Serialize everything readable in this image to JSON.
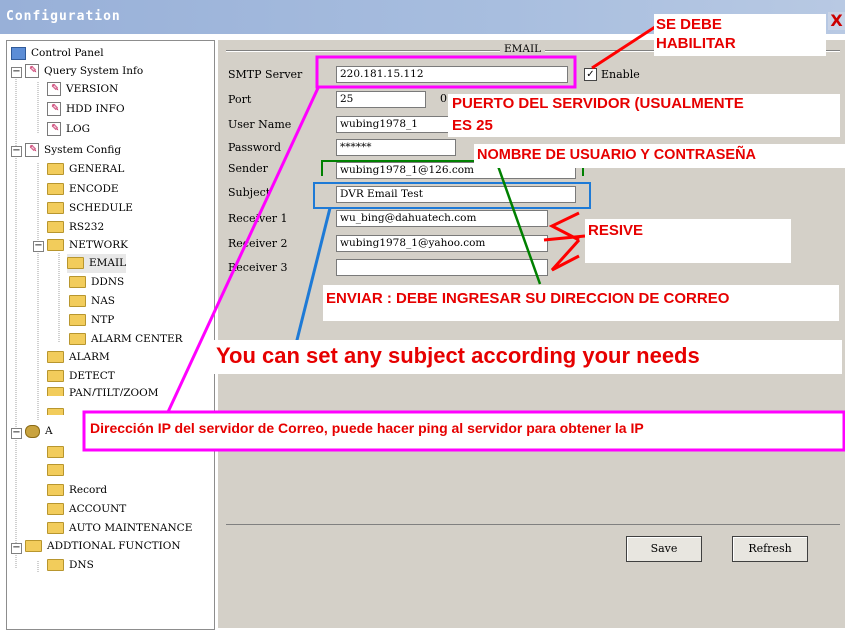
{
  "window": {
    "title": "Configuration",
    "close_glyph": "X"
  },
  "tree": {
    "control_panel": "Control Panel",
    "query_system_info": "Query System Info",
    "version": "VERSION",
    "hdd_info": "HDD INFO",
    "log": "LOG",
    "system_config": "System Config",
    "general": "GENERAL",
    "encode": "ENCODE",
    "schedule": "SCHEDULE",
    "rs232": "RS232",
    "network": "NETWORK",
    "email": "EMAIL",
    "ddns": "DDNS",
    "nas": "NAS",
    "ntp": "NTP",
    "alarm_center": "ALARM CENTER",
    "alarm": "ALARM",
    "detect": "DETECT",
    "pan_tilt_zoom": "PAN/TILT/ZOOM",
    "a_partial": "A",
    "record": "Record",
    "account": "ACCOUNT",
    "auto_maintenance": "AUTO MAINTENANCE",
    "additional_function": "ADDTIONAL FUNCTION",
    "dns": "DNS"
  },
  "email_form": {
    "group_title": "EMAIL",
    "smtp_server_label": "SMTP Server",
    "smtp_server_value": "220.181.15.112",
    "enable_label": "Enable",
    "port_label": "Port",
    "port_value": "25",
    "port_extra": "0^",
    "user_name_label": "User Name",
    "user_name_value": "wubing1978_1",
    "password_label": "Password",
    "password_value": "******",
    "sender_label": "Sender",
    "sender_value": "wubing1978_1@126.com",
    "subject_label": "Subject",
    "subject_value": "DVR Email Test",
    "receiver1_label": "Receiver 1",
    "receiver1_value": "wu_bing@dahuatech.com",
    "receiver2_label": "Receiver 2",
    "receiver2_value": "wubing1978_1@yahoo.com",
    "receiver3_label": "Receiver 3",
    "receiver3_value": ""
  },
  "buttons": {
    "save": "Save",
    "refresh": "Refresh"
  },
  "annotations": {
    "se_debe_1": "SE DEBE",
    "se_debe_2": "HABILITAR",
    "puerto_1": "PUERTO DEL SERVIDOR (USUALMENTE",
    "puerto_2": "ES 25",
    "nombre": "NOMBRE DE USUARIO Y CONTRASEÑA",
    "resive": "RESIVE",
    "enviar": "ENVIAR : DEBE INGRESAR SU DIRECCION DE CORREO",
    "subject_note": "You can set any subject according your needs",
    "ip_note": "Dirección IP del servidor de Correo, puede hacer ping al servidor para obtener la IP"
  },
  "colors": {
    "annotation_red": "#e60000",
    "magenta": "#ff00ff",
    "green": "#008000",
    "blue": "#1e7ad6",
    "title_bar": "#a8bedf",
    "panel_bg": "#d4d0c8"
  }
}
